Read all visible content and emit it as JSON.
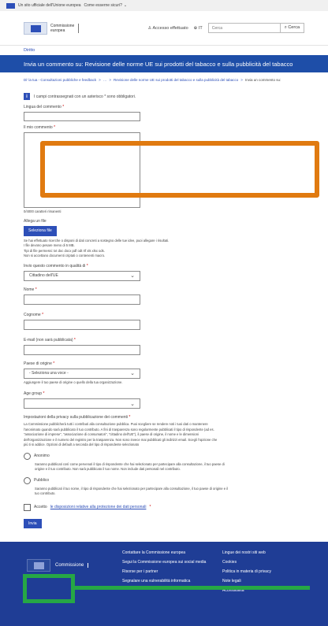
{
  "topbar": {
    "text": "Un sito ufficiale dell'Unione europea",
    "link": "Come esserne sicuri?",
    "chevron": "⌄"
  },
  "header": {
    "logo_line1": "Commissione",
    "logo_line2": "europea",
    "login": "Accesso effettuato",
    "lang": "IT",
    "search_placeholder": "Cerca",
    "search_button": "Cerca",
    "user_icon": "♙",
    "globe_icon": "⊕",
    "search_icon": "⌕"
  },
  "breadline": "Diritto",
  "page_title": "Invia un commento su: Revisione delle norme UE sui prodotti del tabacco e sulla pubblicità del tabacco",
  "breadcrumbs": {
    "items": [
      "Di' la tua - Consultazioni pubbliche e feedback",
      "…",
      "Revisione delle norme UE sui prodotti del tabacco e sulla pubblicità del tabacco"
    ],
    "current": "Invia un commento su:",
    "sep": ">"
  },
  "form": {
    "info_icon": "i",
    "info_text": "I campi contrassegnati con un asterisco * sono obbligatori.",
    "language_label": "Lingua del commento",
    "comment_label": "Il mio commento",
    "chars_remaining": "0/4000 caratteri rimanenti",
    "attach_label": "Allega un file",
    "select_file": "Seleziona file",
    "file_help_1": "Se hai effettuato ricerche o disponi di dati concreti a sostegno delle tue idee, puoi allegare i risultati.",
    "file_help_2": "I file devono pesare meno di 5 MB.",
    "file_help_3": "Tipi di file permessi: txt doc docx pdf odt rtf xls xlsx ods.",
    "file_help_4": "Non si accettano documenti criptati o contenenti macro.",
    "capacity_label": "Invio questo commento in qualità di",
    "capacity_value": "Cittadino dell'UE",
    "firstname_label": "Nome",
    "surname_label": "Cognome",
    "email_label": "E-mail (non sarà pubblicata)",
    "country_label": "Paese di origine",
    "country_value": "- Seleziona una voce -",
    "country_help": "Aggiungere il tuo paese di origine o quello della tua organizzazione.",
    "age_label": "Age group",
    "age_value": "",
    "privacy_title": "Impostazioni della privacy sulla pubblicazione dei commenti",
    "privacy_text": "La Commissione pubblicherà tutti i contributi alla consultazione pubblica. Puoi scegliere se rendere noti i tuoi dati o mantenere l'anonimato quando sarà pubblicato il tuo contributo. A fini di trasparenza sono regolarmente pubblicati il tipo di rispondente (ad es. \"associazione di imprese\", \"associazione di consumatori\", \"cittadino dell'UE\"), il paese di origine, il nome e le dimensioni dell'organizzazione e il numero del registro per la trasparenza. Non sono invece mai pubblicati gli indirizzi email. Scegli l'opzione che più ti si addice. Opzioni di default a seconda del tipo di rispondente selezionato",
    "anon_label": "Anonimo",
    "anon_text": "Saranno pubblicati così come pervenuti il tipo di rispondente che hai selezionato per partecipare alla consultazione, il tuo paese di origine e il tuo contributo. Non sarà pubblicato il tuo nome. Non include dati personali nel contributo.",
    "public_label": "Pubblico",
    "public_text": "Saranno pubblicati il tuo nome, il tipo di rispondente che hai selezionato per partecipare alla consultazione, il tuo paese di origine e il tuo contributo.",
    "accept_prefix": "Accetto",
    "accept_link": "le disposizioni relative alla protezione dei dati personali",
    "submit": "Invia",
    "asterisk": "*",
    "chevron": "⌄"
  },
  "footer": {
    "logo_text": "Commissione",
    "col1": [
      "Contattare la Commissione europea",
      "Segui la Commissione europea sui social media",
      "Risorse per i partner",
      "Segnalare una vulnerabilità informatica"
    ],
    "col2": [
      "Lingue dei nostri siti web",
      "Cookies",
      "Politica in materia di privacy",
      "Note legali",
      "Accessibilità"
    ]
  },
  "annotations": {
    "orange": "#e07a10",
    "green": "#26a745"
  }
}
